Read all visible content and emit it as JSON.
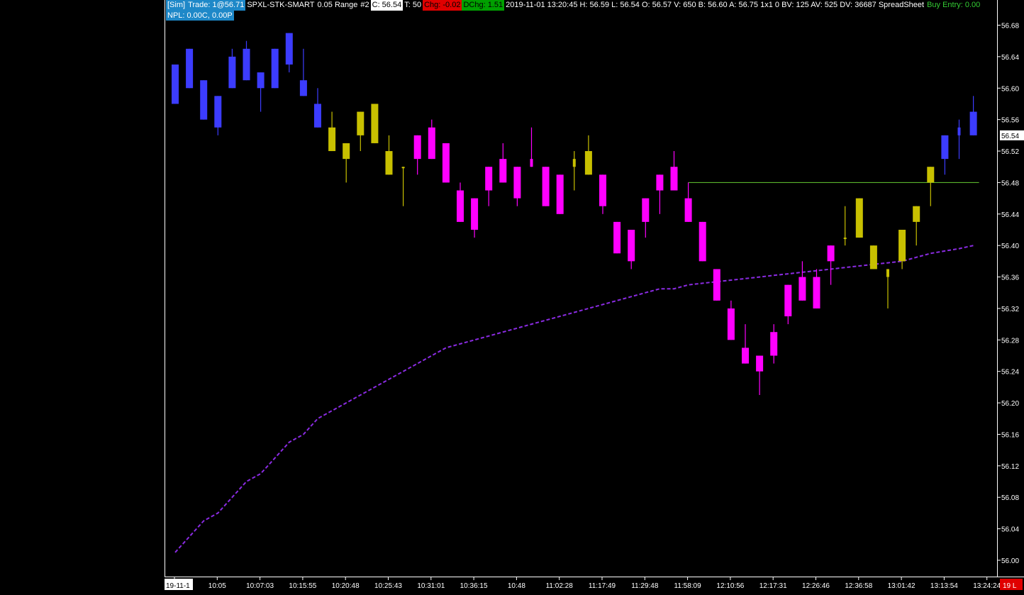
{
  "header": {
    "sim_label": "[Sim]",
    "trade": "Trade: 1@56.71",
    "symbol": "SPXL-STK-SMART",
    "range": "0.05 Range",
    "chart_no": "#2",
    "close": "C: 56.54",
    "ticks": "T: 50",
    "chg": "Chg: -0.02",
    "dchg": "DChg: 1.51",
    "stats": "2019-11-01 13:20:45 H: 56.59 L: 56.54 O: 56.57 V: 650 B: 56.60 A: 56.75 1x1 0 BV: 125 AV: 525 DV: 36687 SpreadSheet",
    "buy_entry": "Buy Entry: 0.00",
    "npl": "NPL: 0.00C, 0.00P"
  },
  "colors": {
    "up_blue": "#3c3cff",
    "down_magenta": "#ff00ff",
    "neutral_yellow": "#c8c000",
    "ma_line": "#8a2be2",
    "entry_line": "#66cc33",
    "chg_bg": "#e00000",
    "dchg_bg": "#00a000",
    "sim_bg": "#1e88c8",
    "last_price_bg": "#ffffff"
  },
  "last_price_label": "56.54",
  "x_first_label": "19-11-1",
  "x_last_label": "19 L",
  "chart_data": {
    "type": "candlestick",
    "ylim": [
      55.98,
      56.7
    ],
    "yticks": [
      "56.00",
      "56.04",
      "56.08",
      "56.12",
      "56.16",
      "56.20",
      "56.24",
      "56.28",
      "56.32",
      "56.36",
      "56.40",
      "56.44",
      "56.48",
      "56.52",
      "56.56",
      "56.60",
      "56.64",
      "56.68"
    ],
    "xticks": [
      {
        "i": 0,
        "label": "19-11-1"
      },
      {
        "i": 3,
        "label": "10:05"
      },
      {
        "i": 6,
        "label": "10:07:03"
      },
      {
        "i": 9,
        "label": "10:15:55"
      },
      {
        "i": 12,
        "label": "10:20:48"
      },
      {
        "i": 15,
        "label": "10:25:43"
      },
      {
        "i": 18,
        "label": "10:31:01"
      },
      {
        "i": 21,
        "label": "10:36:15"
      },
      {
        "i": 24,
        "label": "10:48"
      },
      {
        "i": 27,
        "label": "11:02:28"
      },
      {
        "i": 30,
        "label": "11:17:49"
      },
      {
        "i": 33,
        "label": "11:29:48"
      },
      {
        "i": 36,
        "label": "11:58:09"
      },
      {
        "i": 39,
        "label": "12:10:56"
      },
      {
        "i": 42,
        "label": "12:17:31"
      },
      {
        "i": 45,
        "label": "12:26:46"
      },
      {
        "i": 48,
        "label": "12:36:58"
      },
      {
        "i": 51,
        "label": "13:01:42"
      },
      {
        "i": 54,
        "label": "13:13:54"
      },
      {
        "i": 57,
        "label": "13:24:24"
      }
    ],
    "candles": [
      {
        "o": 56.58,
        "h": 56.63,
        "l": 56.58,
        "c": 56.63,
        "k": "b"
      },
      {
        "o": 56.6,
        "h": 56.65,
        "l": 56.6,
        "c": 56.65,
        "k": "b"
      },
      {
        "o": 56.61,
        "h": 56.61,
        "l": 56.56,
        "c": 56.56,
        "k": "b"
      },
      {
        "o": 56.59,
        "h": 56.59,
        "l": 56.54,
        "c": 56.55,
        "k": "b"
      },
      {
        "o": 56.6,
        "h": 56.65,
        "l": 56.6,
        "c": 56.64,
        "k": "b"
      },
      {
        "o": 56.61,
        "h": 56.66,
        "l": 56.61,
        "c": 56.65,
        "k": "b"
      },
      {
        "o": 56.62,
        "h": 56.62,
        "l": 56.57,
        "c": 56.6,
        "k": "b"
      },
      {
        "o": 56.6,
        "h": 56.65,
        "l": 56.6,
        "c": 56.65,
        "k": "b"
      },
      {
        "o": 56.63,
        "h": 56.67,
        "l": 56.62,
        "c": 56.67,
        "k": "b"
      },
      {
        "o": 56.61,
        "h": 56.65,
        "l": 56.59,
        "c": 56.59,
        "k": "b"
      },
      {
        "o": 56.58,
        "h": 56.6,
        "l": 56.55,
        "c": 56.55,
        "k": "b"
      },
      {
        "o": 56.55,
        "h": 56.57,
        "l": 56.52,
        "c": 56.52,
        "k": "y"
      },
      {
        "o": 56.53,
        "h": 56.53,
        "l": 56.48,
        "c": 56.51,
        "k": "y"
      },
      {
        "o": 56.54,
        "h": 56.57,
        "l": 56.52,
        "c": 56.57,
        "k": "y"
      },
      {
        "o": 56.53,
        "h": 56.58,
        "l": 56.53,
        "c": 56.58,
        "k": "y"
      },
      {
        "o": 56.52,
        "h": 56.54,
        "l": 56.49,
        "c": 56.49,
        "k": "y"
      },
      {
        "o": 56.5,
        "h": 56.5,
        "l": 56.45,
        "c": 56.5,
        "k": "y"
      },
      {
        "o": 56.54,
        "h": 56.54,
        "l": 56.49,
        "c": 56.51,
        "k": "m"
      },
      {
        "o": 56.55,
        "h": 56.56,
        "l": 56.51,
        "c": 56.51,
        "k": "m"
      },
      {
        "o": 56.53,
        "h": 56.53,
        "l": 56.48,
        "c": 56.48,
        "k": "m"
      },
      {
        "o": 56.47,
        "h": 56.48,
        "l": 56.43,
        "c": 56.43,
        "k": "m"
      },
      {
        "o": 56.46,
        "h": 56.46,
        "l": 56.41,
        "c": 56.42,
        "k": "m"
      },
      {
        "o": 56.5,
        "h": 56.5,
        "l": 56.45,
        "c": 56.47,
        "k": "m"
      },
      {
        "o": 56.51,
        "h": 56.53,
        "l": 56.48,
        "c": 56.48,
        "k": "m"
      },
      {
        "o": 56.5,
        "h": 56.5,
        "l": 56.45,
        "c": 56.46,
        "k": "m"
      },
      {
        "o": 56.51,
        "h": 56.55,
        "l": 56.5,
        "c": 56.5,
        "k": "m"
      },
      {
        "o": 56.5,
        "h": 56.5,
        "l": 56.45,
        "c": 56.45,
        "k": "m"
      },
      {
        "o": 56.49,
        "h": 56.49,
        "l": 56.44,
        "c": 56.44,
        "k": "m"
      },
      {
        "o": 56.51,
        "h": 56.52,
        "l": 56.47,
        "c": 56.5,
        "k": "y"
      },
      {
        "o": 56.52,
        "h": 56.54,
        "l": 56.49,
        "c": 56.49,
        "k": "y"
      },
      {
        "o": 56.49,
        "h": 56.49,
        "l": 56.44,
        "c": 56.45,
        "k": "m"
      },
      {
        "o": 56.43,
        "h": 56.43,
        "l": 56.39,
        "c": 56.39,
        "k": "m"
      },
      {
        "o": 56.42,
        "h": 56.42,
        "l": 56.37,
        "c": 56.38,
        "k": "m"
      },
      {
        "o": 56.46,
        "h": 56.46,
        "l": 56.41,
        "c": 56.43,
        "k": "m"
      },
      {
        "o": 56.49,
        "h": 56.49,
        "l": 56.44,
        "c": 56.47,
        "k": "m"
      },
      {
        "o": 56.5,
        "h": 56.52,
        "l": 56.47,
        "c": 56.47,
        "k": "m"
      },
      {
        "o": 56.46,
        "h": 56.48,
        "l": 56.43,
        "c": 56.43,
        "k": "m"
      },
      {
        "o": 56.43,
        "h": 56.43,
        "l": 56.38,
        "c": 56.38,
        "k": "m"
      },
      {
        "o": 56.37,
        "h": 56.37,
        "l": 56.33,
        "c": 56.33,
        "k": "m"
      },
      {
        "o": 56.32,
        "h": 56.33,
        "l": 56.28,
        "c": 56.28,
        "k": "m"
      },
      {
        "o": 56.27,
        "h": 56.3,
        "l": 56.25,
        "c": 56.25,
        "k": "m"
      },
      {
        "o": 56.26,
        "h": 56.26,
        "l": 56.21,
        "c": 56.24,
        "k": "m"
      },
      {
        "o": 56.26,
        "h": 56.3,
        "l": 56.25,
        "c": 56.29,
        "k": "m"
      },
      {
        "o": 56.35,
        "h": 56.35,
        "l": 56.3,
        "c": 56.31,
        "k": "m"
      },
      {
        "o": 56.36,
        "h": 56.38,
        "l": 56.33,
        "c": 56.33,
        "k": "m"
      },
      {
        "o": 56.36,
        "h": 56.37,
        "l": 56.32,
        "c": 56.32,
        "k": "m"
      },
      {
        "o": 56.4,
        "h": 56.4,
        "l": 56.35,
        "c": 56.38,
        "k": "m"
      },
      {
        "o": 56.41,
        "h": 56.45,
        "l": 56.4,
        "c": 56.41,
        "k": "y"
      },
      {
        "o": 56.41,
        "h": 56.46,
        "l": 56.41,
        "c": 56.46,
        "k": "y"
      },
      {
        "o": 56.4,
        "h": 56.4,
        "l": 56.37,
        "c": 56.37,
        "k": "y"
      },
      {
        "o": 56.37,
        "h": 56.37,
        "l": 56.32,
        "c": 56.36,
        "k": "y"
      },
      {
        "o": 56.38,
        "h": 56.42,
        "l": 56.37,
        "c": 56.42,
        "k": "y"
      },
      {
        "o": 56.43,
        "h": 56.45,
        "l": 56.4,
        "c": 56.45,
        "k": "y"
      },
      {
        "o": 56.48,
        "h": 56.5,
        "l": 56.45,
        "c": 56.5,
        "k": "y"
      },
      {
        "o": 56.51,
        "h": 56.54,
        "l": 56.49,
        "c": 56.54,
        "k": "b"
      },
      {
        "o": 56.54,
        "h": 56.56,
        "l": 56.51,
        "c": 56.55,
        "k": "b"
      },
      {
        "o": 56.54,
        "h": 56.59,
        "l": 56.54,
        "c": 56.57,
        "k": "b"
      }
    ],
    "ma": [
      56.01,
      56.03,
      56.05,
      56.06,
      56.08,
      56.1,
      56.11,
      56.13,
      56.15,
      56.16,
      56.18,
      56.19,
      56.2,
      56.21,
      56.22,
      56.23,
      56.24,
      56.25,
      56.26,
      56.27,
      56.275,
      56.28,
      56.285,
      56.29,
      56.295,
      56.3,
      56.305,
      56.31,
      56.315,
      56.32,
      56.325,
      56.33,
      56.335,
      56.34,
      56.345,
      56.345,
      56.35,
      56.352,
      56.354,
      56.356,
      56.358,
      56.36,
      56.362,
      56.364,
      56.366,
      56.368,
      56.37,
      56.372,
      56.374,
      56.376,
      56.378,
      56.38,
      56.385,
      56.39,
      56.393,
      56.396,
      56.4
    ],
    "entry_line": {
      "price": 56.48,
      "from_index": 36,
      "to_index": 56
    }
  }
}
